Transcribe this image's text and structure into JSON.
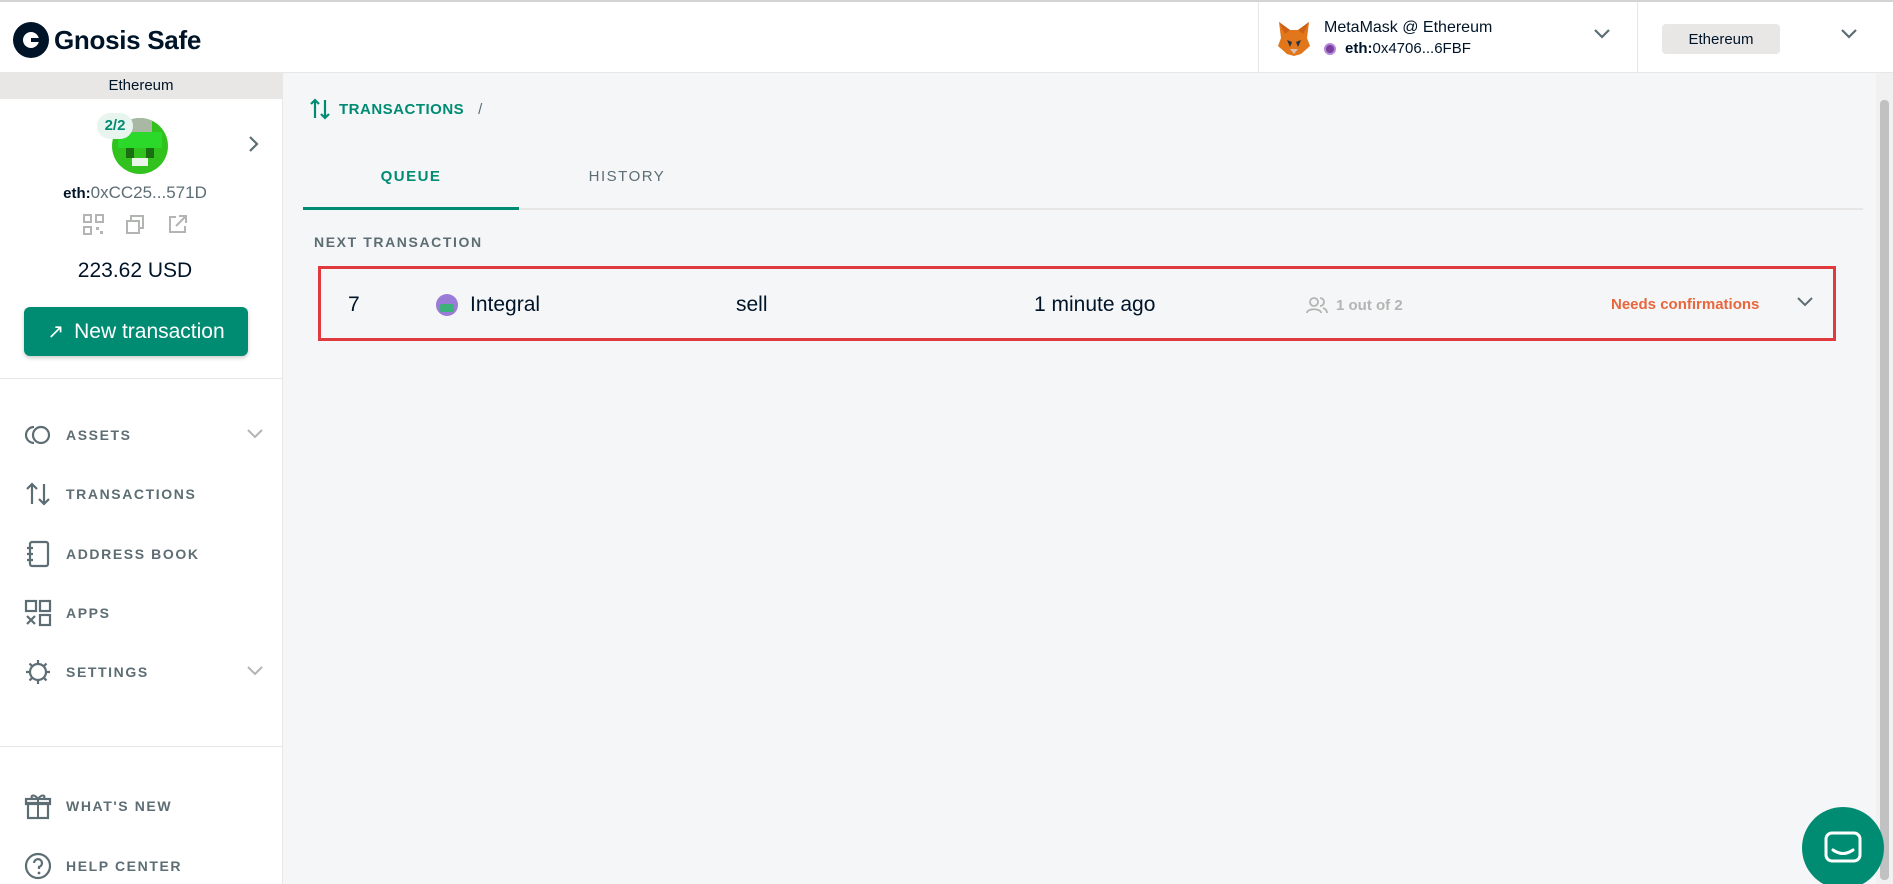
{
  "app": {
    "logo_text": "Gnosis Safe"
  },
  "header": {
    "wallet_name": "MetaMask @ Ethereum",
    "wallet_prefix": "eth:",
    "wallet_address": "0x4706...6FBF",
    "network": "Ethereum"
  },
  "sidebar": {
    "network_label": "Ethereum",
    "threshold": "2/2",
    "address_prefix": "eth:",
    "address": "0xCC25...571D",
    "balance": "223.62 USD",
    "new_tx_label": "New transaction",
    "nav": [
      {
        "label": "ASSETS",
        "icon": "assets-icon",
        "has_chevron": true
      },
      {
        "label": "TRANSACTIONS",
        "icon": "transactions-icon",
        "has_chevron": false
      },
      {
        "label": "ADDRESS BOOK",
        "icon": "address-book-icon",
        "has_chevron": false
      },
      {
        "label": "APPS",
        "icon": "apps-icon",
        "has_chevron": false
      },
      {
        "label": "SETTINGS",
        "icon": "settings-icon",
        "has_chevron": true
      }
    ],
    "footer_nav": [
      {
        "label": "WHAT'S NEW",
        "icon": "gift-icon"
      },
      {
        "label": "HELP CENTER",
        "icon": "help-icon"
      }
    ]
  },
  "main": {
    "breadcrumb": "TRANSACTIONS",
    "breadcrumb_sep": "/",
    "tabs": [
      {
        "label": "QUEUE",
        "active": true
      },
      {
        "label": "HISTORY",
        "active": false
      }
    ],
    "section_title": "NEXT TRANSACTION",
    "transaction": {
      "nonce": "7",
      "app": "Integral",
      "method": "sell",
      "time": "1 minute ago",
      "confirmations": "1 out of 2",
      "status": "Needs confirmations"
    }
  },
  "colors": {
    "primary": "#008c73",
    "status_warning": "#e8663d",
    "highlight_border": "#e0393e"
  }
}
